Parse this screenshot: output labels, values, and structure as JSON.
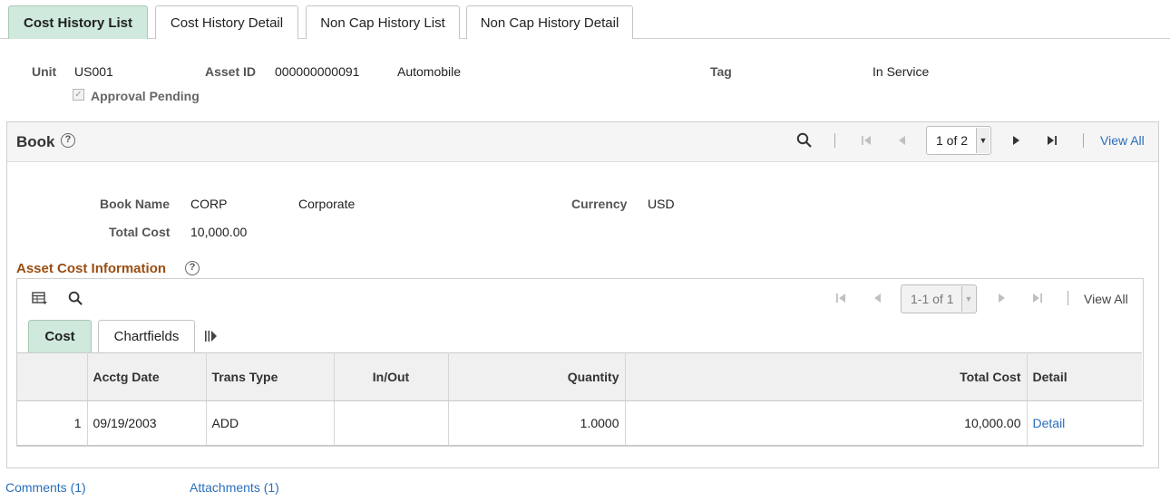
{
  "tabs": [
    {
      "label": "Cost History List",
      "active": true
    },
    {
      "label": "Cost History Detail",
      "active": false
    },
    {
      "label": "Non Cap History List",
      "active": false
    },
    {
      "label": "Non Cap History Detail",
      "active": false
    }
  ],
  "header": {
    "unit_label": "Unit",
    "unit_value": "US001",
    "asset_id_label": "Asset ID",
    "asset_id_value": "000000000091",
    "asset_desc": "Automobile",
    "tag_label": "Tag",
    "status": "In Service",
    "approval_pending_label": "Approval Pending",
    "approval_pending_checked": true
  },
  "book": {
    "title": "Book",
    "pager": "1 of 2",
    "view_all": "View All",
    "book_name_label": "Book Name",
    "book_name_value": "CORP",
    "book_desc": "Corporate",
    "currency_label": "Currency",
    "currency_value": "USD",
    "total_cost_label": "Total Cost",
    "total_cost_value": "10,000.00"
  },
  "asset_cost": {
    "title": "Asset Cost Information",
    "pager": "1-1 of 1",
    "view_all": "View All",
    "tabs": [
      {
        "label": "Cost",
        "active": true
      },
      {
        "label": "Chartfields",
        "active": false
      }
    ],
    "columns": [
      "",
      "Acctg Date",
      "Trans Type",
      "In/Out",
      "Quantity",
      "Total Cost",
      "Detail"
    ],
    "rows": [
      {
        "num": "1",
        "acctg_date": "09/19/2003",
        "trans_type": "ADD",
        "in_out": "",
        "quantity": "1.0000",
        "total_cost": "10,000.00",
        "detail": "Detail"
      }
    ]
  },
  "footer": {
    "comments": "Comments (1)",
    "attachments": "Attachments (1)"
  },
  "colors": {
    "active_tab": "#cfe9dd",
    "link": "#2a6ebb",
    "section_title": "#9b4e12"
  }
}
